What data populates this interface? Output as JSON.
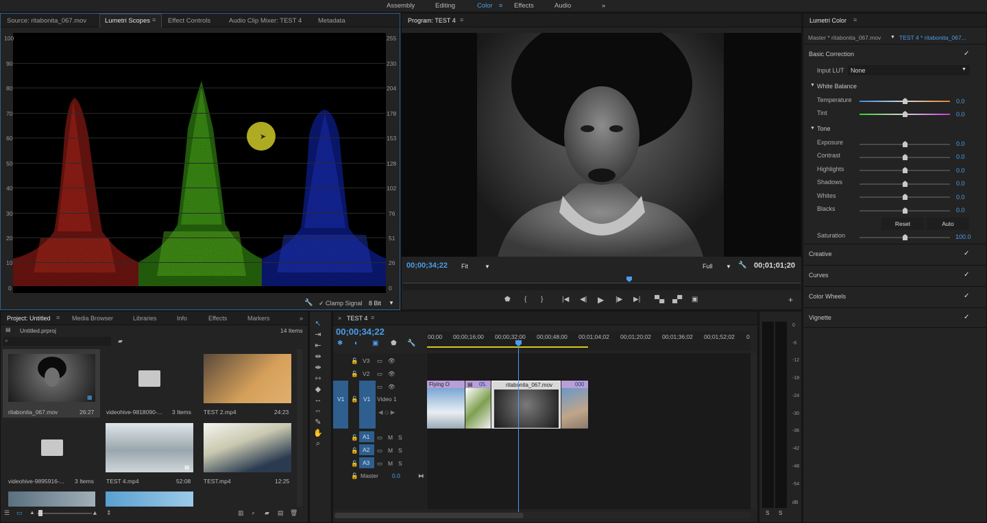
{
  "workspaces": [
    "Assembly",
    "Editing",
    "Color",
    "Effects",
    "Audio"
  ],
  "workspace_active": "Color",
  "workspace_more": "»",
  "source_panel": {
    "tabs": [
      "Source: ritabonita_067.mov",
      "Lumetri Scopes",
      "Effect Controls",
      "Audio Clip Mixer: TEST 4",
      "Metadata"
    ],
    "active_tab": "Lumetri Scopes",
    "scope_left_scale": [
      "100",
      "90",
      "80",
      "70",
      "60",
      "50",
      "40",
      "30",
      "20",
      "10",
      "0"
    ],
    "scope_right_scale": [
      "255",
      "230",
      "204",
      "178",
      "153",
      "128",
      "102",
      "76",
      "51",
      "26",
      "0"
    ],
    "clamp_signal_label": "Clamp Signal",
    "bit_depth": "8 Bit"
  },
  "program_monitor": {
    "title": "Program: TEST 4",
    "timecode_current": "00;00;34;22",
    "zoom": "Fit",
    "quality": "Full",
    "timecode_duration": "00;01;01;20",
    "playhead_fraction": 0.57
  },
  "lumetri": {
    "title": "Lumetri Color",
    "master_label": "Master * ritabonita_067.mov",
    "sequence_label": "TEST 4 * ritabonita_067...",
    "basic_correction": "Basic Correction",
    "input_lut_label": "Input LUT",
    "input_lut_value": "None",
    "white_balance": "White Balance",
    "temperature": {
      "label": "Temperature",
      "value": "0.0"
    },
    "tint": {
      "label": "Tint",
      "value": "0.0"
    },
    "tone": "Tone",
    "tone_rows": [
      {
        "label": "Exposure",
        "value": "0.0"
      },
      {
        "label": "Contrast",
        "value": "0.0"
      },
      {
        "label": "Highlights",
        "value": "0.0"
      },
      {
        "label": "Shadows",
        "value": "0.0"
      },
      {
        "label": "Whites",
        "value": "0.0"
      },
      {
        "label": "Blacks",
        "value": "0.0"
      }
    ],
    "reset_label": "Reset",
    "auto_label": "Auto",
    "saturation": {
      "label": "Saturation",
      "value": "100.0"
    },
    "sections": [
      "Creative",
      "Curves",
      "Color Wheels",
      "Vignette"
    ],
    "check": "✓"
  },
  "project": {
    "tabs": [
      "Project: Untitled",
      "Media Browser",
      "Libraries",
      "Info",
      "Effects",
      "Markers"
    ],
    "file_name": "Untitled.prproj",
    "item_count": "14 Items",
    "items": [
      {
        "name": "ritabonita_067.mov",
        "meta": "26:27"
      },
      {
        "name": "videohive-9818090-...",
        "meta": "3 Items"
      },
      {
        "name": "TEST 2.mp4",
        "meta": "24:23"
      },
      {
        "name": "videohive-9895916-...",
        "meta": "3 Items"
      },
      {
        "name": "TEST 4.mp4",
        "meta": "52:08"
      },
      {
        "name": "TEST.mp4",
        "meta": "12:25"
      }
    ]
  },
  "timeline": {
    "sequence_tab": "TEST 4",
    "timecode": "00;00;34;22",
    "ruler": [
      "00;00",
      "00;00;16;00",
      "00;00;32;00",
      "00;00;48;00",
      "00;01;04;02",
      "00;01;20;02",
      "00;01;36;02",
      "00;01;52;02",
      "0"
    ],
    "video_tracks": [
      "V3",
      "V2",
      "V1"
    ],
    "source_patch_v": "V1",
    "video1_name": "Video 1",
    "audio_tracks": [
      "A1",
      "A2",
      "A3"
    ],
    "master_label": "Master",
    "master_value": "0.0",
    "clips": [
      "Flying O",
      "05.",
      "ritabonita_067.mov",
      "000"
    ]
  },
  "meter": {
    "scale": [
      "0",
      "-6",
      "-12",
      "-18",
      "-24",
      "-30",
      "-36",
      "-42",
      "-48",
      "-54",
      "dB"
    ],
    "solo": [
      "S",
      "S"
    ]
  }
}
